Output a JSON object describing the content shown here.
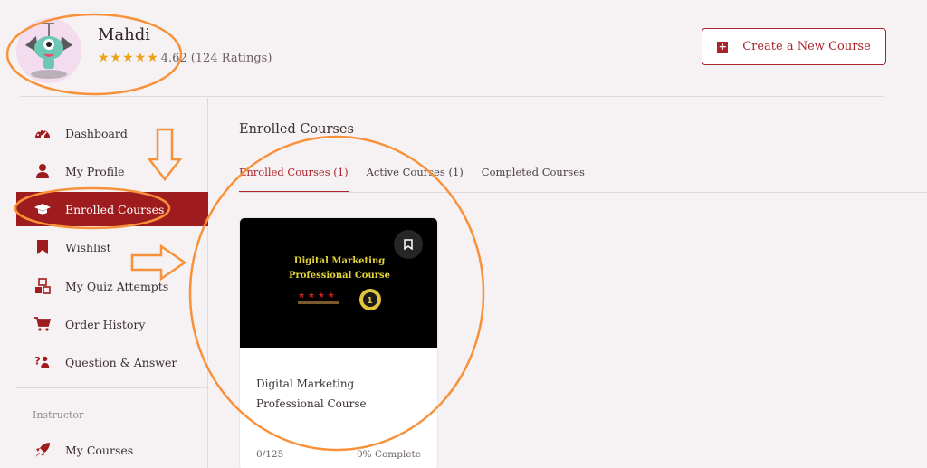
{
  "header": {
    "user_name": "Mahdi",
    "stars": "★★★★★",
    "rating_value": "4.62",
    "rating_count": "(124 Ratings)",
    "create_course_label": "Create a New Course"
  },
  "sidebar": {
    "items": [
      {
        "label": "Dashboard",
        "icon": "dashboard-gauge-icon"
      },
      {
        "label": "My Profile",
        "icon": "user-icon"
      },
      {
        "label": "Enrolled Courses",
        "icon": "graduation-cap-icon"
      },
      {
        "label": "Wishlist",
        "icon": "bookmark-icon"
      },
      {
        "label": "My Quiz Attempts",
        "icon": "quiz-blocks-icon"
      },
      {
        "label": "Order History",
        "icon": "cart-icon"
      },
      {
        "label": "Question & Answer",
        "icon": "question-answer-icon"
      }
    ],
    "section_label": "Instructor",
    "instructor_items": [
      {
        "label": "My Courses",
        "icon": "rocket-icon"
      }
    ]
  },
  "content": {
    "title": "Enrolled Courses",
    "tabs": [
      {
        "label": "Enrolled Courses (1)",
        "active": true
      },
      {
        "label": "Active Courses (1)",
        "active": false
      },
      {
        "label": "Completed Courses",
        "active": false
      }
    ]
  },
  "course_card": {
    "thumbnail_line1": "Digital Marketing",
    "thumbnail_line2": "Professional Course",
    "title": "Digital Marketing Professional Course",
    "lessons_progress": "0/125",
    "complete_label": "0% Complete"
  },
  "colors": {
    "accent": "#9e1c1e",
    "annotation": "#f7923a",
    "background": "#f6f1f3",
    "star": "#e8a317"
  }
}
